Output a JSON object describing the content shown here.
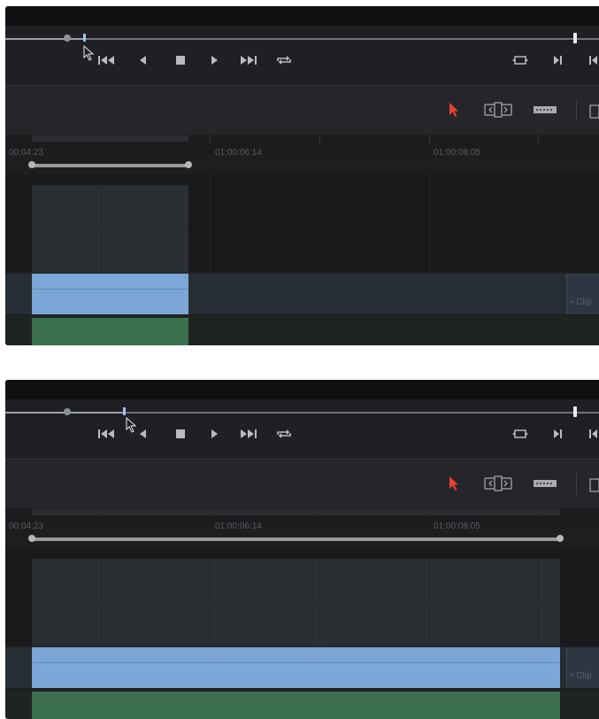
{
  "panels": [
    {
      "id": "before",
      "ruler": {
        "tc_left": "00:04:23",
        "tc_mid": "01:00:06:14",
        "tc_right": "01:00:08:05"
      },
      "right_clip_label": "• Clip"
    },
    {
      "id": "after",
      "ruler": {
        "tc_left": "00:04:23",
        "tc_mid": "01:00:06:14",
        "tc_right": "01:00:08:05"
      },
      "right_clip_label": "• Clip"
    }
  ],
  "transport": {
    "first_frame": "first-frame-icon",
    "reverse": "reverse-play-icon",
    "stop": "stop-icon",
    "play": "play-icon",
    "last_frame": "last-frame-icon",
    "loop": "loop-icon",
    "match_frame": "match-frame-icon",
    "next_clip": "next-clip-icon"
  },
  "toolbar": {
    "selection": "selection-arrow-icon",
    "trim": "trim-edit-icon",
    "blade": "blade-icon"
  },
  "colors": {
    "selection_tool": "#e8412f",
    "audio_clip": "#7ba6d6",
    "video_clip": "#3b6f4e"
  }
}
